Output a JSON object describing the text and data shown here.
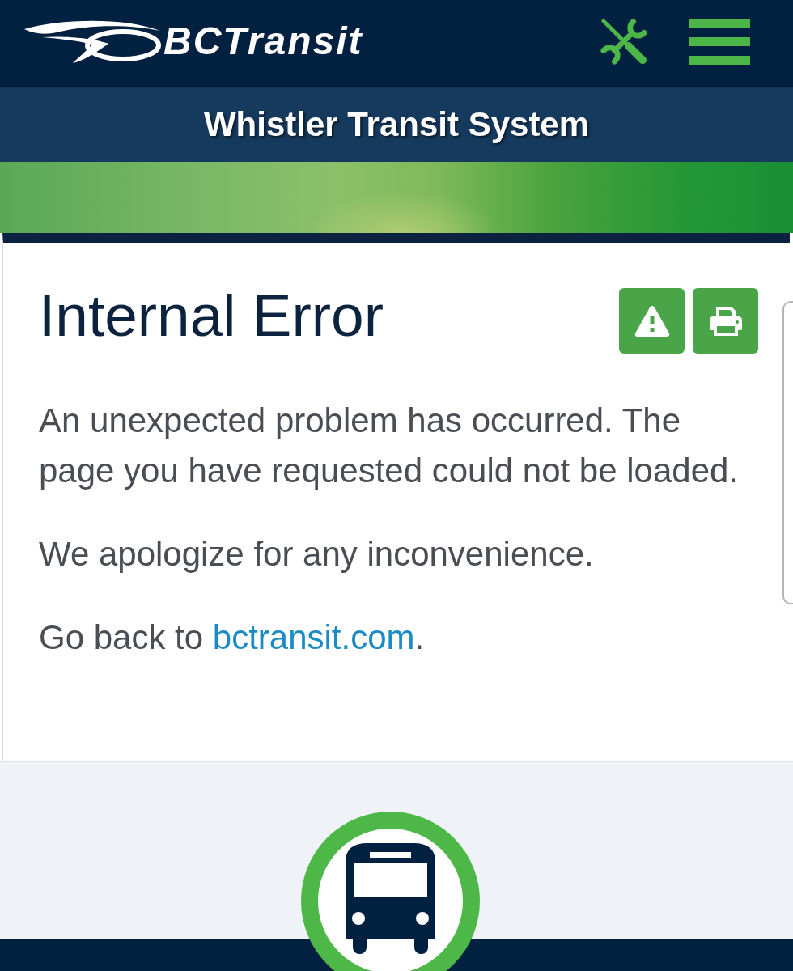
{
  "header": {
    "logo_text": "BCTransit"
  },
  "system_bar": {
    "title": "Whistler Transit System"
  },
  "content": {
    "title": "Internal Error",
    "paragraphs": [
      {
        "kind": "text",
        "text": "An unexpected problem has occurred. The page you have requested could not be loaded."
      },
      {
        "kind": "text",
        "text": "We apologize for any inconvenience."
      },
      {
        "kind": "link",
        "text": "Go back to",
        "link_text": "bctransit.com",
        "after": "."
      }
    ]
  }
}
